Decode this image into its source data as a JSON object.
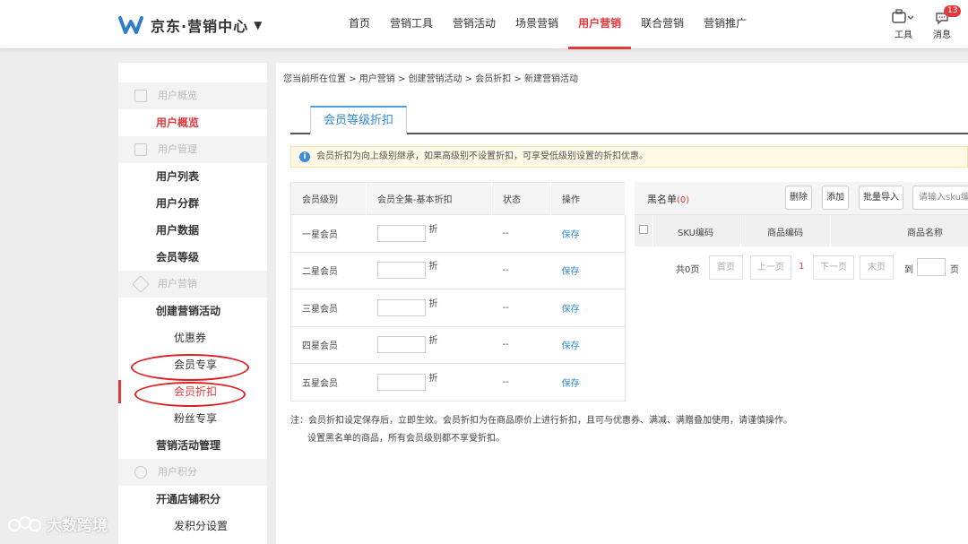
{
  "header": {
    "logo_text": "京东·营销中心",
    "logo_caret": "▼",
    "nav": [
      "首页",
      "营销工具",
      "营销活动",
      "场景营销",
      "用户营销",
      "联合营销",
      "营销推广"
    ],
    "active_nav": "用户营销",
    "tools_label": "工具",
    "messages_label": "消息",
    "messages_count": "13",
    "accent_color": "#e4393c"
  },
  "sidebar": {
    "group_overview": "用户概览",
    "item_overview": "用户概览",
    "group_manage": "用户管理",
    "item_list": "用户列表",
    "item_group": "用户分群",
    "item_data": "用户数据",
    "item_level": "会员等级",
    "group_marketing": "用户营销",
    "item_create": "创建营销活动",
    "sub_coupon": "优惠券",
    "sub_exclusive": "会员专享",
    "sub_discount": "会员折扣",
    "sub_fans": "粉丝专享",
    "item_manage_activity": "营销活动管理",
    "group_points": "用户积分",
    "item_open_points": "开通店铺积分",
    "sub_issue_points": "发积分设置"
  },
  "main": {
    "breadcrumb": "您当前所在位置 > 用户营销 > 创建营销活动 > 会员折扣 > 新建营销活动",
    "tab": "会员等级折扣",
    "notice": "会员折扣为向上级别继承，如果高级别不设置折扣，可享受低级别设置的折扣优惠。",
    "notice_icon": "i",
    "level_table": {
      "headers": [
        "会员级别",
        "会员全集-基本折扣",
        "状态",
        "操作"
      ],
      "unit": "折",
      "status": "--",
      "action": "保存",
      "rows": [
        "一星会员",
        "二星会员",
        "三星会员",
        "四星会员",
        "五星会员"
      ]
    },
    "blacklist": {
      "title": "黑名单",
      "count": "(0)",
      "delete_btn": "删除",
      "add_btn": "添加",
      "batch_btn": "批量导入",
      "search_placeholder": "请输入sku编号",
      "col_sku": "SKU编码",
      "col_code": "商品编码",
      "col_name": "商品名称",
      "pager_total": "共0页",
      "first": "首页",
      "prev": "上一页",
      "page": "1",
      "next": "下一页",
      "last": "末页",
      "goto": "到",
      "page_unit": "页"
    },
    "note_line1": "注：会员折扣设定保存后，立即生效。会员折扣为在商品原价上进行折扣，且可与优惠券、满减、满赠叠加使用，请谨慎操作。",
    "note_line2": "设置黑名单的商品，所有会员级别都不享受折扣。"
  },
  "watermark": "大数跨境"
}
